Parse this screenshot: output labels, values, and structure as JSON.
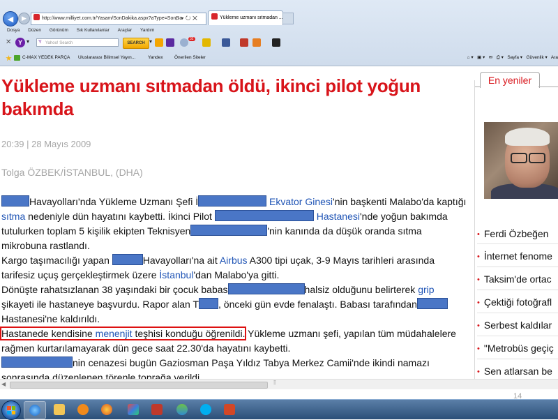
{
  "browser": {
    "address_url": "http://www.milliyet.com.tr/Yasam/SonDakika.aspx?aType=SonDa",
    "tab_title": "Yükleme uzmanı sıtmadan ...",
    "menu": [
      "Dosya",
      "Düzen",
      "Görünüm",
      "Sık Kullanılanlar",
      "Araçlar",
      "Yardım"
    ],
    "search_placeholder": "Yahoo! Search",
    "search_button": "SEARCH",
    "mail_badge": "32",
    "favorites": [
      "C-MAX YEDEK PARÇA",
      "Uluslararası Bilimsel Yayın...",
      "Yandex",
      "Önerilen Siteler"
    ],
    "ie_tools": [
      "Sayfa",
      "Güvenlik",
      "Ara"
    ]
  },
  "article": {
    "headline_1": "Yükleme uzmanı sıtmadan öldü, ikinci pilot yoğun",
    "headline_2": "bakımda",
    "date": "20:39 | 28 Mayıs 2009",
    "byline": "Tolga ÖZBEK/İSTANBUL, (DHA)",
    "p1": {
      "t1": "Havayolları'nda Yükleme Uzmanı Şefi İ",
      "l1": "Ekvator Ginesi",
      "t2": "'nin başkenti Malabo'da kaptığı ",
      "l2": "sıtma",
      "t3": " nedeniyle dün hayatını kaybetti. İkinci Pilot ",
      "l3": "Hastanesi",
      "t4": "'nde yoğun bakımda tutulurken toplam 5 kişilik ekipten Teknisyen",
      "t5": "'nin kanında da düşük oranda sıtma mikrobuna rastlandı."
    },
    "p2": {
      "t1": "Kargo taşımacılığı yapan ",
      "t2": "Havayolları'na ait ",
      "l1": "Airbus",
      "t3": " A300 tipi uçak, 3-9 Mayıs tarihleri arasında tarifesiz uçuş gerçekleştirmek üzere ",
      "l2": "İstanbul",
      "t4": "'dan Malabo'ya gitti."
    },
    "p3": {
      "t1": "Dönüşte rahatsızlanan 38 yaşındaki bir çocuk babas",
      "t2": "halsiz olduğunu belirterek ",
      "l1": "grip",
      "t3": " şikayeti ile hastaneye başvurdu. Rapor alan T",
      "t4": ", önceki gün evde fenalaştı. Babası tarafından",
      "t5": " Hastanesi'ne kaldırıldı."
    },
    "p4": {
      "h1": "Hastanede kendisine ",
      "hl": "menenjit",
      "h2": " teşhisi konduğu öğrenildi.",
      "t1": " Yükleme uzmanı şefi, yapılan tüm müdahalelere rağmen kurtarılamayarak dün gece saat 22.30'da hayatını kaybetti."
    },
    "p5": {
      "t1": "nin cenazesi bugün Gaziosman Paşa Yıldız Tabya Merkez Camii'nde ikindi namazı sonrasında düzenlenen törenle toprağa verildi."
    }
  },
  "sidebar": {
    "tab": "En yeniler",
    "items": [
      "Ferdi Özbeğen",
      "İnternet fenome",
      "Taksim'de ortac",
      "Çektiği fotoğrafl",
      "Serbest kaldılar",
      "\"Metrobüs geçiç",
      "Sen atlarsan be"
    ]
  },
  "slide": {
    "page_number": "14"
  },
  "taskbar": {
    "apps": [
      "internet-explorer",
      "file-explorer",
      "media-player",
      "firefox",
      "paint",
      "spss",
      "messenger",
      "skype",
      "powerpoint"
    ]
  },
  "colors": {
    "headline": "#d8141a",
    "link": "#1f54b5",
    "redaction": "#4a76c6",
    "highlight_box": "#dd1111"
  }
}
